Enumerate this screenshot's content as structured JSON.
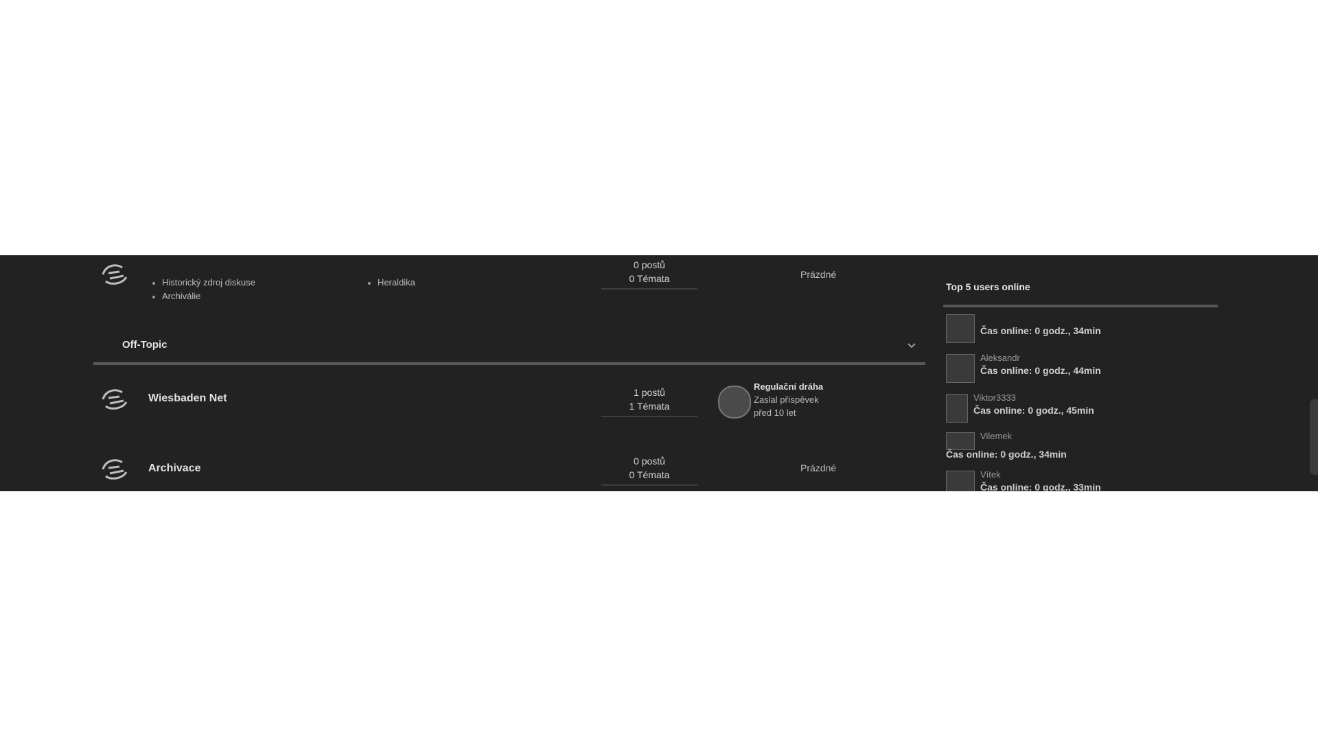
{
  "forums": {
    "top_row": {
      "subforums_left": [
        "Historický zdroj diskuse",
        "Archiválie"
      ],
      "subforums_right": [
        "Heraldika"
      ],
      "stats_line1": "0 postů",
      "stats_line2": "0 Témata",
      "last_post": "Prázdné"
    },
    "section": {
      "title": "Off-Topic",
      "chevron_icon": "chevron-down-icon"
    },
    "rows": [
      {
        "title": "Wiesbaden Net",
        "stats_line1": "1 postů",
        "stats_line2": "1 Témata",
        "last_post_title": "Regulační dráha",
        "last_post_line2": "Zaslal příspěvek",
        "last_post_line3": "před 10 let"
      },
      {
        "title": "Archivace",
        "stats_line1": "0 postů",
        "stats_line2": "0 Témata",
        "last_post": "Prázdné"
      }
    ]
  },
  "sidebar": {
    "title": "Top 5 users online",
    "users": [
      {
        "name": "",
        "status": "Čas online: 0 godz., 34min"
      },
      {
        "name": "Aleksandr",
        "status": "Čas online: 0 godz., 44min"
      },
      {
        "name": "Viktor3333",
        "status": "Čas online: 0 godz., 45min"
      },
      {
        "name": "Vilemek",
        "status": "Čas online: 0 godz., 34min"
      },
      {
        "name": "Vítek",
        "status": "Čas online: 0 godz., 33min"
      }
    ]
  },
  "colors": {
    "background": "#222222",
    "page": "#ffffff",
    "rule": "#5a5a5a"
  }
}
